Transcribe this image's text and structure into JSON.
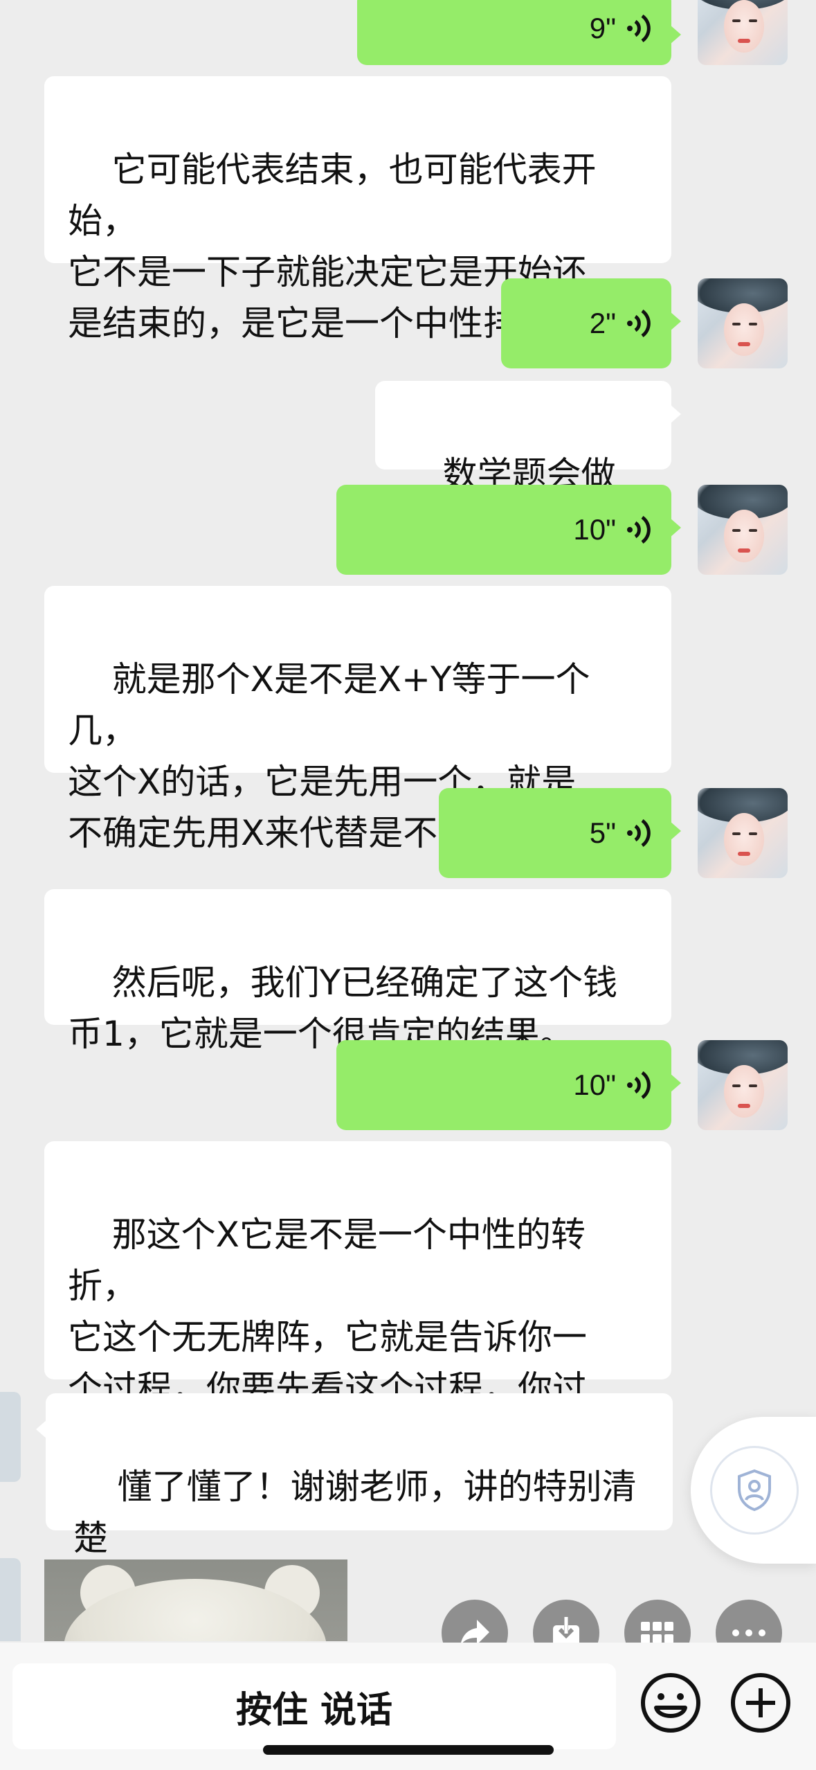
{
  "messages": {
    "voice_1": {
      "duration": "9\""
    },
    "text_1": {
      "text": "它可能代表结束，也可能代表开始，\n它不是一下子就能决定它是开始还\n是结束的，是它是一个中性排气。"
    },
    "voice_2": {
      "duration": "2\""
    },
    "text_right_1": {
      "text": "数学题会做吧?"
    },
    "voice_3": {
      "duration": "10\""
    },
    "text_2": {
      "text": "就是那个X是不是X+Y等于一个几，\n这个X的话，它是先用一个，就是\n不确定先用X来代替是不是。"
    },
    "voice_4": {
      "duration": "5\""
    },
    "text_3": {
      "text": "然后呢，我们Y已经确定了这个钱\n币1，它就是一个很肯定的结果。"
    },
    "voice_5": {
      "duration": "10\""
    },
    "text_4": {
      "text": "那这个X它是不是一个中性的转折，\n它这个无无牌阵，它就是告诉你一\n个过程，你要先看这个过程，你过\n程你推导出来之后，你再推导结果。"
    },
    "text_left_1": {
      "text": "懂了懂了！谢谢老师，讲的特别清\n楚"
    }
  },
  "input_bar": {
    "hold_to_talk": "按住 说话"
  },
  "icons": {
    "voice_wave": "voice-wave-icon",
    "forward": "forward-icon",
    "save": "save-icon",
    "grid": "grid-icon",
    "more": "more-icon",
    "emoji": "emoji-icon",
    "plus": "plus-icon",
    "security": "shield-icon"
  },
  "colors": {
    "green_bubble": "#95ec69",
    "background": "#ededed"
  }
}
